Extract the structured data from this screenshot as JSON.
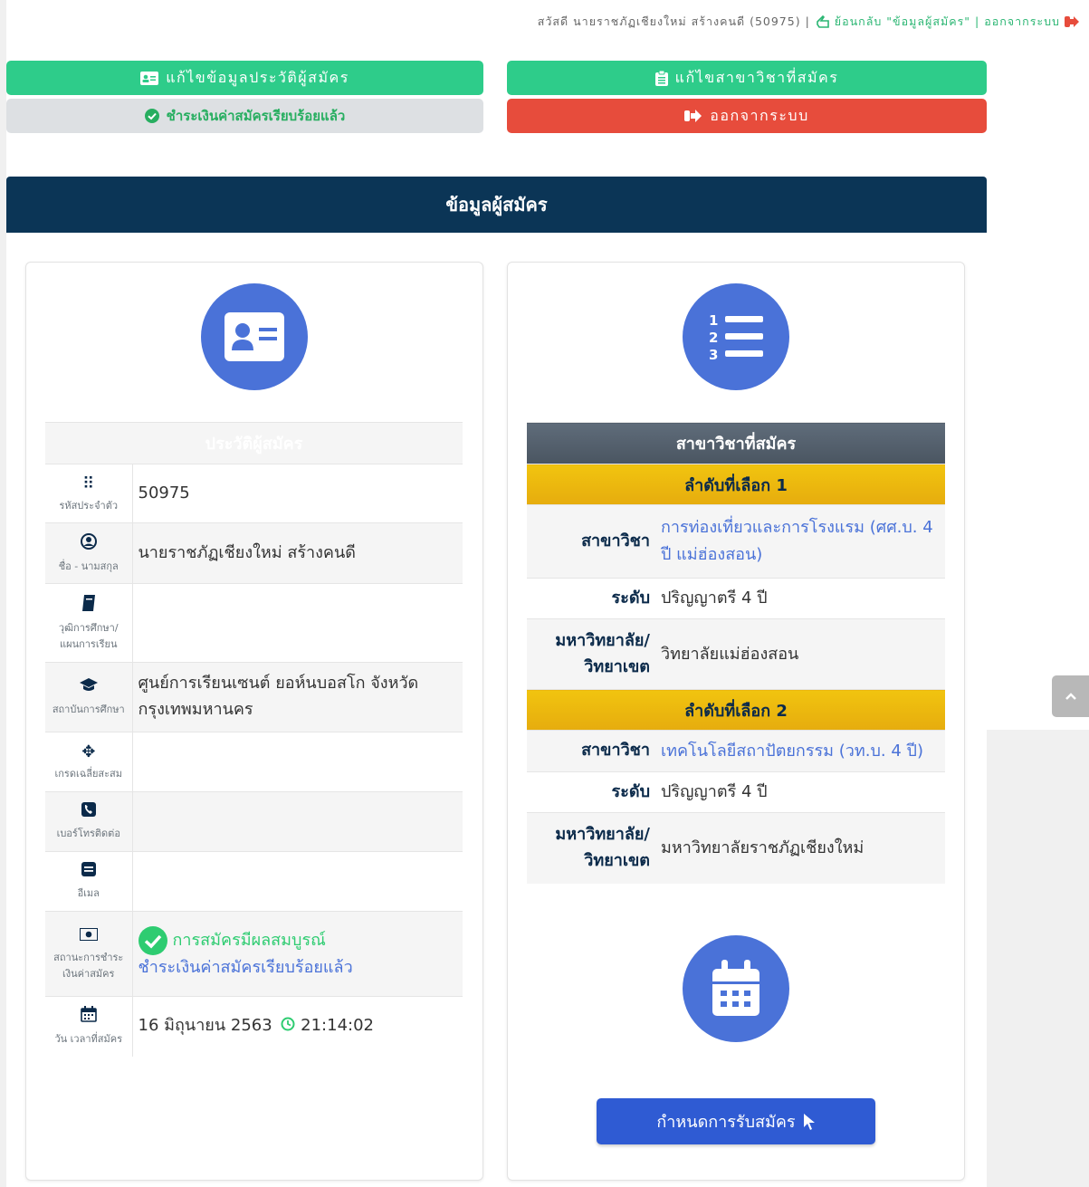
{
  "topbar": {
    "greeting": "สวัสดี นายราชภัฏเชียงใหม่ สร้างคนดี (50975) |",
    "back_label": "ย้อนกลับ \"ข้อมูลผู้สมัคร\" |",
    "logout_label": "ออกจากระบบ"
  },
  "buttons": {
    "edit_profile": "แก้ไขข้อมูลประวัติผู้สมัคร",
    "edit_major": "แก้ไขสาขาวิชาที่สมัคร",
    "paid_status": "ชำระเงินค่าสมัครเรียบร้อยแล้ว",
    "logout": "ออกจากระบบ",
    "schedule": "กำหนดการรับสมัคร"
  },
  "page_title": "ข้อมูลผู้สมัคร",
  "profile": {
    "heading": "ประวัติผู้สมัคร",
    "rows": [
      {
        "label": "รหัสประจำตัว",
        "value": "50975"
      },
      {
        "label": "ชื่อ - นามสกุล",
        "value": "นายราชภัฏเชียงใหม่ สร้างคนดี"
      },
      {
        "label": "วุฒิการศึกษา/ แผนการเรียน",
        "value": ""
      },
      {
        "label": "สถาบันการศึกษา",
        "value": "ศูนย์การเรียนเซนต์ ยอห์นบอสโก จังหวัดกรุงเทพมหานคร"
      },
      {
        "label": "เกรดเฉลี่ยสะสม",
        "value": ""
      },
      {
        "label": "เบอร์โทรติดต่อ",
        "value": ""
      },
      {
        "label": "อีเมล",
        "value": ""
      },
      {
        "label": "สถานะการชำระเงินค่าสมัคร",
        "value": ""
      },
      {
        "label": "วัน เวลาที่สมัคร",
        "value": ""
      }
    ],
    "payment_complete": "การสมัครมีผลสมบูรณ์",
    "payment_detail": "ชำระเงินค่าสมัครเรียบร้อยแล้ว",
    "apply_date": "16 มิถุนายน 2563",
    "apply_time": "21:14:02"
  },
  "majors": {
    "heading": "สาขาวิชาที่สมัคร",
    "label_major": "สาขาวิชา",
    "label_level": "ระดับ",
    "label_uni": "มหาวิทยาลัย/ วิทยาเขต",
    "choices": [
      {
        "title": "ลำดับที่เลือก 1",
        "major": "การท่องเที่ยวและการโรงแรม (ศศ.บ. 4 ปี แม่ฮ่องสอน)",
        "level": "ปริญญาตรี 4 ปี",
        "uni": "วิทยาลัยแม่ฮ่องสอน"
      },
      {
        "title": "ลำดับที่เลือก 2",
        "major": "เทคโนโลยีสถาปัตยกรรม (วท.บ. 4 ปี)",
        "level": "ปริญญาตรี 4 ปี",
        "uni": "มหาวิทยาลัยราชภัฏเชียงใหม่"
      }
    ]
  },
  "icons": {
    "profile_card": "id-card-icon",
    "majors_card": "numbered-list-icon",
    "calendar": "calendar-icon"
  }
}
